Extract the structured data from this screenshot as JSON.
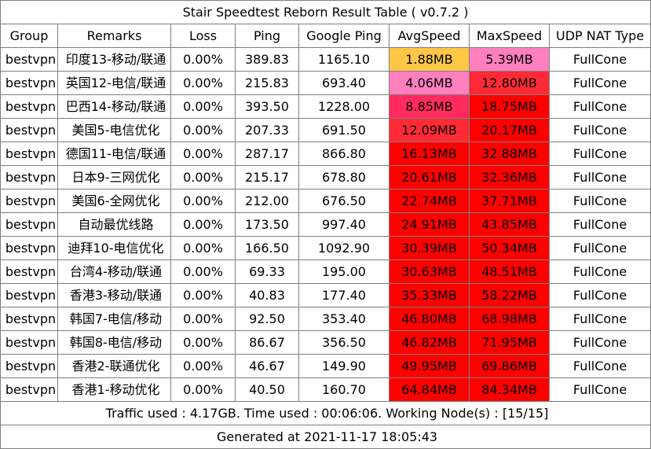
{
  "title": "Stair Speedtest Reborn Result Table ( v0.7.2 )",
  "headers": [
    "Group",
    "Remarks",
    "Loss",
    "Ping",
    "Google Ping",
    "AvgSpeed",
    "MaxSpeed",
    "UDP NAT Type"
  ],
  "rows": [
    {
      "group": "bestvpn",
      "remarks": "印度13-移动/联通",
      "loss": "0.00%",
      "ping": "389.83",
      "google_ping": "1165.10",
      "avg_speed": "1.88MB",
      "max_speed": "5.39MB",
      "udp_nat": "FullCone",
      "avg_color": "#ffc745",
      "max_color": "#ff7fbf"
    },
    {
      "group": "bestvpn",
      "remarks": "英国12-电信/联通",
      "loss": "0.00%",
      "ping": "215.83",
      "google_ping": "693.40",
      "avg_speed": "4.06MB",
      "max_speed": "12.80MB",
      "udp_nat": "FullCone",
      "avg_color": "#ff7fbf",
      "max_color": "#ff2a36"
    },
    {
      "group": "bestvpn",
      "remarks": "巴西14-移动/联通",
      "loss": "0.00%",
      "ping": "393.50",
      "google_ping": "1228.00",
      "avg_speed": "8.85MB",
      "max_speed": "18.75MB",
      "udp_nat": "FullCone",
      "avg_color": "#ff2a5e",
      "max_color": "#ff0000"
    },
    {
      "group": "bestvpn",
      "remarks": "美国5-电信优化",
      "loss": "0.00%",
      "ping": "207.33",
      "google_ping": "691.50",
      "avg_speed": "12.09MB",
      "max_speed": "20.17MB",
      "udp_nat": "FullCone",
      "avg_color": "#ff2a36",
      "max_color": "#ff0000"
    },
    {
      "group": "bestvpn",
      "remarks": "德国11-电信/联通",
      "loss": "0.00%",
      "ping": "287.17",
      "google_ping": "866.80",
      "avg_speed": "16.13MB",
      "max_speed": "32.88MB",
      "udp_nat": "FullCone",
      "avg_color": "#ff0000",
      "max_color": "#ff0000"
    },
    {
      "group": "bestvpn",
      "remarks": "日本9-三网优化",
      "loss": "0.00%",
      "ping": "215.17",
      "google_ping": "678.80",
      "avg_speed": "20.61MB",
      "max_speed": "32.36MB",
      "udp_nat": "FullCone",
      "avg_color": "#ff0000",
      "max_color": "#ff0000"
    },
    {
      "group": "bestvpn",
      "remarks": "美国6-全网优化",
      "loss": "0.00%",
      "ping": "212.00",
      "google_ping": "676.50",
      "avg_speed": "22.74MB",
      "max_speed": "37.71MB",
      "udp_nat": "FullCone",
      "avg_color": "#ff0000",
      "max_color": "#ff0000"
    },
    {
      "group": "bestvpn",
      "remarks": "自动最优线路",
      "loss": "0.00%",
      "ping": "173.50",
      "google_ping": "997.40",
      "avg_speed": "24.91MB",
      "max_speed": "43.85MB",
      "udp_nat": "FullCone",
      "avg_color": "#ff0000",
      "max_color": "#ff0000"
    },
    {
      "group": "bestvpn",
      "remarks": "迪拜10-电信优化",
      "loss": "0.00%",
      "ping": "166.50",
      "google_ping": "1092.90",
      "avg_speed": "30.39MB",
      "max_speed": "50.34MB",
      "udp_nat": "FullCone",
      "avg_color": "#ff0000",
      "max_color": "#ff0000"
    },
    {
      "group": "bestvpn",
      "remarks": "台湾4-移动/联通",
      "loss": "0.00%",
      "ping": "69.33",
      "google_ping": "195.00",
      "avg_speed": "30.63MB",
      "max_speed": "48.51MB",
      "udp_nat": "FullCone",
      "avg_color": "#ff0000",
      "max_color": "#ff0000"
    },
    {
      "group": "bestvpn",
      "remarks": "香港3-移动/联通",
      "loss": "0.00%",
      "ping": "40.83",
      "google_ping": "177.40",
      "avg_speed": "35.33MB",
      "max_speed": "58.22MB",
      "udp_nat": "FullCone",
      "avg_color": "#ff0000",
      "max_color": "#ff0000"
    },
    {
      "group": "bestvpn",
      "remarks": "韩国7-电信/移动",
      "loss": "0.00%",
      "ping": "92.50",
      "google_ping": "353.40",
      "avg_speed": "46.80MB",
      "max_speed": "68.98MB",
      "udp_nat": "FullCone",
      "avg_color": "#ff0000",
      "max_color": "#ff0000"
    },
    {
      "group": "bestvpn",
      "remarks": "韩国8-电信/移动",
      "loss": "0.00%",
      "ping": "86.67",
      "google_ping": "356.50",
      "avg_speed": "46.82MB",
      "max_speed": "71.95MB",
      "udp_nat": "FullCone",
      "avg_color": "#ff0000",
      "max_color": "#ff0000"
    },
    {
      "group": "bestvpn",
      "remarks": "香港2-联通优化",
      "loss": "0.00%",
      "ping": "46.67",
      "google_ping": "149.90",
      "avg_speed": "49.95MB",
      "max_speed": "69.86MB",
      "udp_nat": "FullCone",
      "avg_color": "#ff0000",
      "max_color": "#ff0000"
    },
    {
      "group": "bestvpn",
      "remarks": "香港1-移动优化",
      "loss": "0.00%",
      "ping": "40.50",
      "google_ping": "160.70",
      "avg_speed": "64.84MB",
      "max_speed": "84.34MB",
      "udp_nat": "FullCone",
      "avg_color": "#ff0000",
      "max_color": "#ff0000"
    }
  ],
  "traffic_line": "Traffic used : 4.17GB. Time used : 00:06:06. Working Node(s) : [15/15]",
  "generated_line": "Generated at 2021-11-17 18:05:43"
}
